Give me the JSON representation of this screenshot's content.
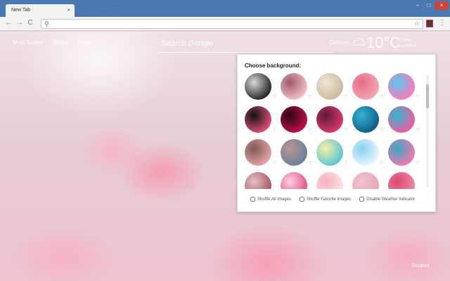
{
  "browser": {
    "tab_title": "New Tab",
    "tab_close": "×",
    "ghost_tabs": "· · · ·  ·· ···  · ··· ··",
    "nav_back": "←",
    "nav_forward": "→",
    "nav_reload": "C",
    "star": "☆",
    "menu": "⋮",
    "win_min": "–",
    "win_max": "□",
    "win_close": "×"
  },
  "top_links": [
    "Most Visited",
    "Share",
    "Rate"
  ],
  "search": {
    "placeholder": "Search Google"
  },
  "options_label": "Options",
  "weather": {
    "temp": "10°C",
    "condition": "Clear",
    "location": "London"
  },
  "panel": {
    "title": "Choose background:",
    "thumbs": [
      {
        "c1": "#d8d8d8",
        "c2": "#222222"
      },
      {
        "c1": "#9d5a6b",
        "c2": "#f3c2c8"
      },
      {
        "c1": "#efe6d6",
        "c2": "#c9b89b"
      },
      {
        "c1": "#e56d87",
        "c2": "#f2a8b6"
      },
      {
        "c1": "#58c7f0",
        "c2": "#ff79b7"
      },
      {
        "c1": "#111111",
        "c2": "#e0507a"
      },
      {
        "c1": "#2b0712",
        "c2": "#c0104a"
      },
      {
        "c1": "#601838",
        "c2": "#d93a6c"
      },
      {
        "c1": "#32b3d6",
        "c2": "#0d5d82"
      },
      {
        "c1": "#2fb7d0",
        "c2": "#f05aa0"
      },
      {
        "c1": "#7b5a55",
        "c2": "#e7a3a9"
      },
      {
        "c1": "#b99591",
        "c2": "#6a7f99"
      },
      {
        "c1": "#f8f0a5",
        "c2": "#57c6d8"
      },
      {
        "c1": "#87d2ee",
        "c2": "#e9f6ff"
      },
      {
        "c1": "#3aa7c7",
        "c2": "#f279aa"
      },
      {
        "c1": "#e3c0c6",
        "c2": "#a85560"
      },
      {
        "c1": "#fbd0e0",
        "c2": "#e14f8a"
      },
      {
        "c1": "#f7b3bf",
        "c2": "#fde2e4"
      },
      {
        "c1": "#f0c2cc",
        "c2": "#e9a6b6"
      },
      {
        "c1": "#d94a70",
        "c2": "#f28aa4"
      }
    ],
    "heart": "♡",
    "checkboxes": [
      "Shuffle All Images",
      "Shuffle Favorite Images",
      "Disable Weather Indicator"
    ]
  },
  "support_label": "Support"
}
